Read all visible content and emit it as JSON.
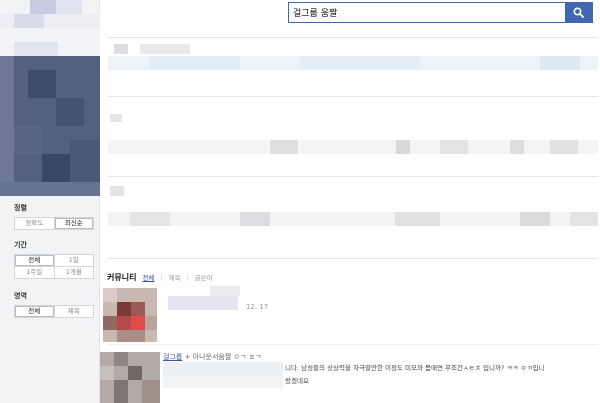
{
  "search": {
    "query": "걸그룹 움짤"
  },
  "filters": {
    "sort": {
      "title": "정렬",
      "options": [
        "정확도",
        "최신순"
      ],
      "selected": "최신순"
    },
    "period": {
      "title": "기간",
      "row1": [
        "전체",
        "1일"
      ],
      "row2": [
        "1주일",
        "1개월"
      ],
      "selected": "전체"
    },
    "area": {
      "title": "영역",
      "options": [
        "전체",
        "제목"
      ],
      "selected": "전체"
    }
  },
  "community": {
    "title": "커뮤니티",
    "tabs": [
      "전체",
      "제목",
      "글쓴이"
    ],
    "active_tab": "전체",
    "items": [
      {
        "date": "12. 17"
      },
      {
        "title": "걸그룹",
        "tail": "+ 아나운서움짤 ㅇㄱ ㅍㄱ",
        "snippet": "니다. 남성들의 상상력을 자극할만한 이정도 미모와 몸매면 무조건ㅅㅌㅊ 입니까? ㅋㅋ ㅇㄲ입니",
        "snippet2": "왔겠네요"
      }
    ]
  },
  "colors": {
    "accent": "#4267b2",
    "link": "#365899"
  }
}
